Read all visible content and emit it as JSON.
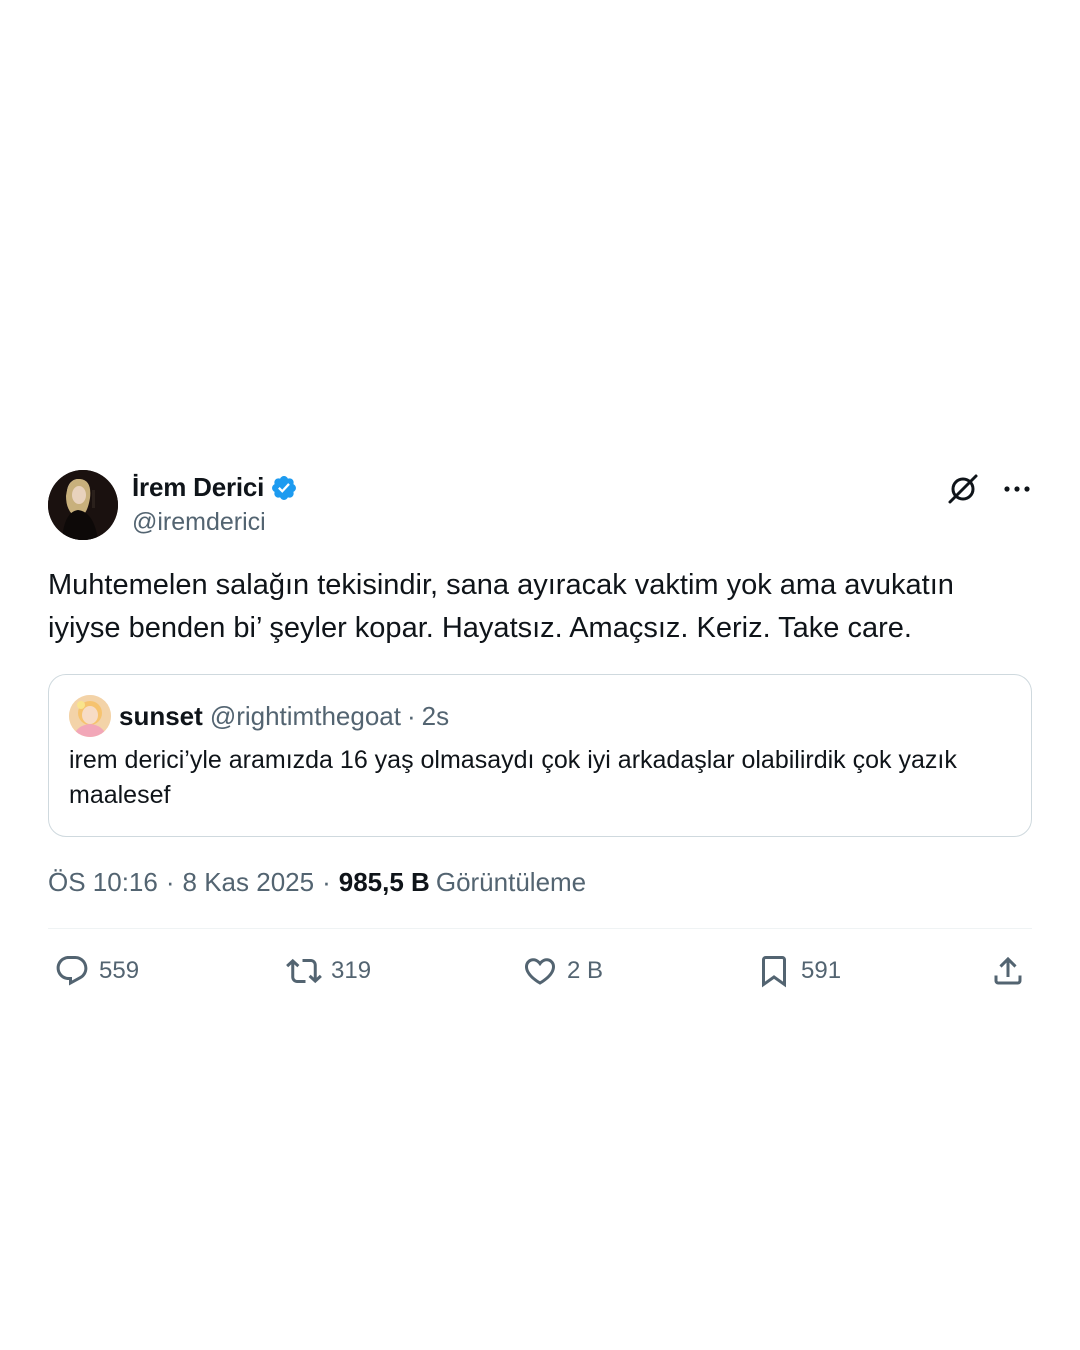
{
  "author": {
    "name": "İrem Derici",
    "handle": "@iremderici",
    "verified_color": "#1d9bf0"
  },
  "icons": {
    "verified": "verified-badge-icon",
    "grok": "grok-icon",
    "more": "more-options-icon",
    "reply": "reply-icon",
    "retweet": "retweet-icon",
    "like": "heart-icon",
    "bookmark": "bookmark-icon",
    "share": "share-icon"
  },
  "tweet_text": "Muhtemelen salağın tekisindir, sana ayıracak vaktim yok ama avukatın iyiyse benden bi’ şeyler kopar. Hayatsız. Amaçsız. Keriz. Take care.",
  "quote": {
    "name": "sunset",
    "handle": "@rightimthegoat",
    "separator": "·",
    "time": "2s",
    "text": "irem derici’yle aramızda 16 yaş olmasaydı çok iyi arkadaşlar olabilirdik çok yazık maalesef"
  },
  "meta": {
    "time": "ÖS 10:16",
    "separator": "·",
    "date": "8 Kas 2025",
    "views_count": "985,5 B",
    "views_label": "Görüntüleme"
  },
  "stats": {
    "replies": "559",
    "retweets": "319",
    "likes": "2 B",
    "bookmarks": "591"
  },
  "colors": {
    "text": "#0f1419",
    "secondary": "#536471",
    "border": "#cfd9de",
    "divider": "#eff3f4"
  }
}
